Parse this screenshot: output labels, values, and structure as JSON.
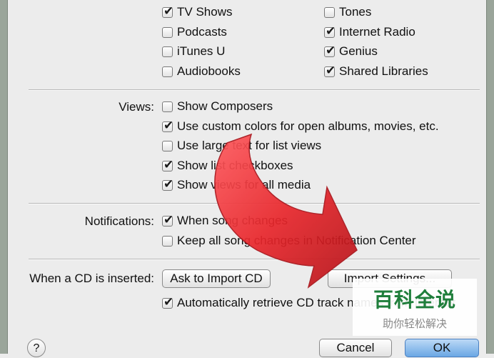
{
  "sources": {
    "left": [
      {
        "label": "TV Shows",
        "checked": true
      },
      {
        "label": "Podcasts",
        "checked": false
      },
      {
        "label": "iTunes U",
        "checked": false
      },
      {
        "label": "Audiobooks",
        "checked": false
      }
    ],
    "right": [
      {
        "label": "Tones",
        "checked": false
      },
      {
        "label": "Internet Radio",
        "checked": true
      },
      {
        "label": "Genius",
        "checked": true
      },
      {
        "label": "Shared Libraries",
        "checked": true
      }
    ]
  },
  "views": {
    "label": "Views:",
    "options": [
      {
        "label": "Show Composers",
        "checked": false
      },
      {
        "label": "Use custom colors for open albums, movies, etc.",
        "checked": true
      },
      {
        "label": "Use large text for list views",
        "checked": false
      },
      {
        "label": "Show list checkboxes",
        "checked": true
      },
      {
        "label": "Show views for all media",
        "checked": true
      }
    ]
  },
  "notifications": {
    "label": "Notifications:",
    "options": [
      {
        "label": "When song changes",
        "checked": true
      },
      {
        "label": "Keep all song changes in Notification Center",
        "checked": false
      }
    ]
  },
  "cd": {
    "label": "When a CD is inserted:",
    "action_value": "Ask to Import CD",
    "import_settings_label": "Import Settings...",
    "auto_retrieve_label": "Automatically retrieve CD track names from Internet",
    "auto_retrieve_checked": true
  },
  "footer": {
    "help_label": "?",
    "cancel_label": "Cancel",
    "ok_label": "OK"
  },
  "watermark": {
    "title": "百科全说",
    "subtitle": "助你轻松解决"
  },
  "colors": {
    "arrow": "#e8262b",
    "ok_button": "#6aa7e4",
    "watermark_green": "#1f7e3b"
  }
}
